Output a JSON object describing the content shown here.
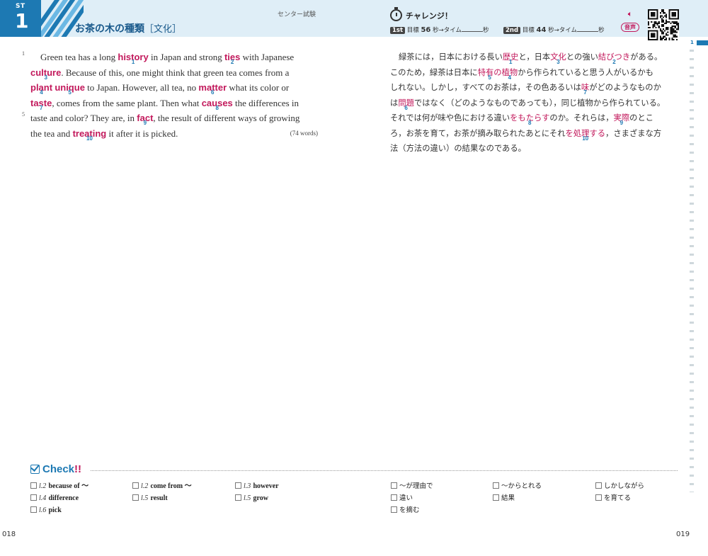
{
  "header": {
    "lesson_prefix": "ST",
    "lesson_number": "1",
    "title": "お茶の木の種類",
    "title_tag": "［文化］",
    "source": "センター試験"
  },
  "challenge": {
    "label": "チャレンジ！",
    "rounds": [
      {
        "badge": "1st",
        "target_label": "目標",
        "target": "56",
        "unit_after": "秒→タイム",
        "seconds_unit": "秒"
      },
      {
        "badge": "2nd",
        "target_label": "目標",
        "target": "44",
        "unit_after": "秒→タイム",
        "seconds_unit": "秒"
      }
    ]
  },
  "audio": {
    "label": "音声"
  },
  "edge_index": {
    "number": "1"
  },
  "passage_en": {
    "line_numbers": [
      "1",
      "5"
    ],
    "lines": [
      [
        {
          "t": "Green tea has a long "
        },
        {
          "k": "history",
          "n": "1"
        },
        {
          "t": " in Japan and strong "
        },
        {
          "k": "ties",
          "n": "2"
        },
        {
          "t": " with Japanese"
        }
      ],
      [
        {
          "k": "culture",
          "n": "3"
        },
        {
          "t": ".  Because of this, one might think that green tea comes from a"
        }
      ],
      [
        {
          "k": "plant",
          "n": "4"
        },
        {
          "t": " "
        },
        {
          "k": "unique",
          "n": "5"
        },
        {
          "t": " to Japan.  However, all tea, no "
        },
        {
          "k": "matter",
          "n": "6"
        },
        {
          "t": " what its color or"
        }
      ],
      [
        {
          "k": "taste",
          "n": "7"
        },
        {
          "t": ", comes from the same plant.  Then what "
        },
        {
          "k": "causes",
          "n": "8"
        },
        {
          "t": " the differences in"
        }
      ],
      [
        {
          "t": "taste and color?  They are, in "
        },
        {
          "k": "fact",
          "n": "9"
        },
        {
          "t": ", the result of different ways of growing"
        }
      ],
      [
        {
          "t": "the tea and "
        },
        {
          "k": "treating",
          "n": "10"
        },
        {
          "t": " it after it is picked."
        }
      ]
    ],
    "word_count": "(74 words)"
  },
  "passage_jp": {
    "lines": [
      [
        {
          "t": "緑茶には，日本における長い"
        },
        {
          "k": "歴史",
          "n": "1"
        },
        {
          "t": "と，日本"
        },
        {
          "k": "文化",
          "n": "3"
        },
        {
          "t": "との強い"
        },
        {
          "k": "結びつき",
          "n": "2"
        },
        {
          "t": "がある。"
        }
      ],
      [
        {
          "t": "このため，緑茶は日本に"
        },
        {
          "k": "特有の",
          "n": "5"
        },
        {
          "k": "植物",
          "n": "4"
        },
        {
          "t": "から作られていると思う人がいるかも"
        }
      ],
      [
        {
          "t": "しれない。しかし，すべてのお茶は，その色あるいは"
        },
        {
          "k": "味",
          "n": "7"
        },
        {
          "t": "がどのようなものか"
        }
      ],
      [
        {
          "t": "は"
        },
        {
          "k": "問題",
          "n": "6"
        },
        {
          "t": "ではなく（どのようなものであっても），同じ植物から作られている。"
        }
      ],
      [
        {
          "t": "それでは何が味や色における違い"
        },
        {
          "k": "をもたらす",
          "n": "8"
        },
        {
          "t": "のか。それらは，"
        },
        {
          "k": "実際",
          "n": "9"
        },
        {
          "t": "のとこ"
        }
      ],
      [
        {
          "t": "ろ，お茶を育て，お茶が摘み取られたあとにそれ"
        },
        {
          "k": "を処理する",
          "n": "10"
        },
        {
          "t": "，さまざまな方"
        }
      ],
      [
        {
          "t": "法（方法の違い）の結果なのである。"
        }
      ]
    ]
  },
  "check": {
    "title": "Check",
    "title_excl": "!!",
    "items_en": [
      {
        "ln": "l.2",
        "phrase": "because of ～"
      },
      {
        "ln": "l.2",
        "phrase": "come from ～"
      },
      {
        "ln": "l.3",
        "phrase": "however"
      },
      {
        "ln": "l.4",
        "phrase": "difference"
      },
      {
        "ln": "l.5",
        "phrase": "result"
      },
      {
        "ln": "l.5",
        "phrase": "grow"
      },
      {
        "ln": "l.6",
        "phrase": "pick"
      }
    ],
    "items_jp": [
      "～が理由で",
      "～からとれる",
      "しかしながら",
      "違い",
      "結果",
      "を育てる",
      "を摘む"
    ]
  },
  "pages": {
    "left": "018",
    "right": "019"
  },
  "colors": {
    "accent_blue": "#1d79b3",
    "keyword_magenta": "#c2185b",
    "header_band": "#dfeef7"
  },
  "icons": [
    "timer-icon",
    "speaker-icon",
    "qr-code",
    "checkbox-icon"
  ]
}
